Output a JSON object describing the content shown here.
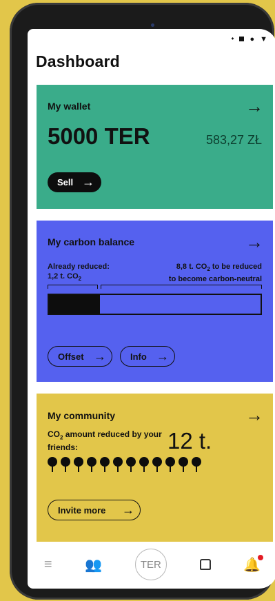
{
  "status_icons": [
    "location-icon",
    "square-icon",
    "circle-icon",
    "signal-icon"
  ],
  "page_title": "Dashboard",
  "wallet": {
    "title": "My wallet",
    "amount": "5000 TER",
    "fiat": "583,27 ZŁ",
    "sell_label": "Sell",
    "color": "#3aac8a"
  },
  "carbon": {
    "title": "My carbon balance",
    "reduced_label": "Already reduced:",
    "reduced_value": "1,2 t. CO",
    "remaining_value": "8,8 t. CO",
    "remaining_tail": " to be reduced",
    "remaining_line2": "to  become carbon-neutral",
    "progress_fraction": 0.24,
    "offset_label": "Offset",
    "info_label": "Info",
    "color": "#5561ef"
  },
  "community": {
    "title": "My community",
    "co2_prefix": "CO",
    "co2_rest": " amount reduced by your friends:",
    "amount": "12 t.",
    "friends_count": 12,
    "invite_label": "Invite more",
    "color": "#e2c64a"
  },
  "navbar": {
    "items": [
      "menu-icon",
      "friends-icon",
      "ter-icon",
      "home-icon",
      "notifications-icon"
    ],
    "ter_label": "TER"
  }
}
